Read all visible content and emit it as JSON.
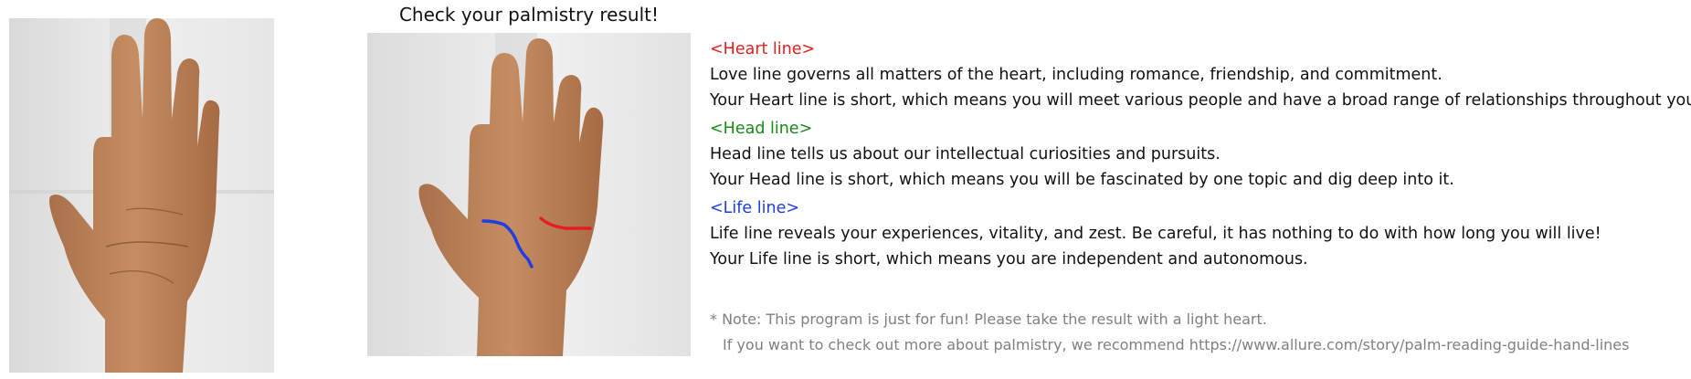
{
  "title": "Check your palmistry result!",
  "colors": {
    "heart": "#e41e1e",
    "head": "#1a8a1a",
    "life": "#1e3de4",
    "note": "#808080"
  },
  "sections": [
    {
      "header": "<Heart line>",
      "color_key": "heart",
      "lines": [
        "Love line governs all matters of the heart, including romance, friendship, and commitment.",
        "Your Heart line is short, which means you will meet various people and have a broad range of relationships throughout your life."
      ]
    },
    {
      "header": "<Head line>",
      "color_key": "head",
      "lines": [
        "Head line tells us about our intellectual curiosities and pursuits.",
        "Your Head line is short, which means you will be fascinated by one topic and dig deep into it."
      ]
    },
    {
      "header": "<Life line>",
      "color_key": "life",
      "lines": [
        "Life line reveals your experiences, vitality, and zest. Be careful, it has nothing to do with how long you will live!",
        "Your Life line is short, which means you are independent and autonomous."
      ]
    }
  ],
  "note": {
    "line1": "* Note: This program is just for fun! Please take the result with a light heart.",
    "line2": "If you want to check out more about palmistry, we recommend https://www.allure.com/story/palm-reading-guide-hand-lines"
  }
}
